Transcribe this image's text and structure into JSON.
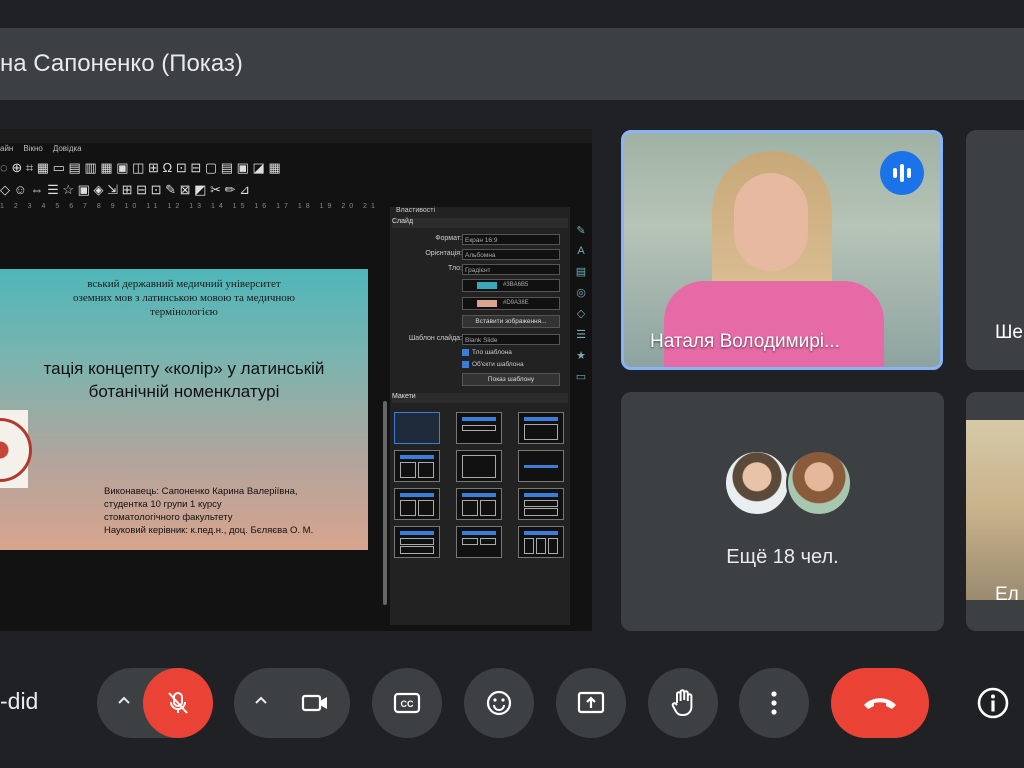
{
  "header": {
    "presenter_title": "на Сапоненко (Показ)"
  },
  "shared_screen": {
    "menu": [
      "айн",
      "Вікно",
      "Довідка"
    ],
    "slide": {
      "university_lines": [
        "вський державний медичний університет",
        "оземних мов з латинською мовою та медичною",
        "термінологією"
      ],
      "heading_lines": [
        "тація концепту «колір» у латинській",
        "ботанічній номенклатурі"
      ],
      "credits": "Виконавець: Сапоненко Карина Валеріївна,\nстудентка 10 групи 1 курсу\nстоматологічного факультету\nНауковий керівник: к.пед.н., доц. Бєляєва О. М."
    },
    "properties": {
      "panel_title": "Властивості",
      "slide_section": "Слайд",
      "format_label": "Формат:",
      "format_value": "Екран 16:9",
      "orientation_label": "Орієнтація:",
      "orientation_value": "Альбомна",
      "background_label": "Тло:",
      "background_value": "Градієнт",
      "color1": "#3BA6B5",
      "color1_label": "#3BA6B5",
      "color2": "#D9A38E",
      "color2_label": "#D9A38E",
      "insert_image_button": "Вставити зображення...",
      "master_label": "Шаблон слайда:",
      "master_value": "Blank Slide",
      "check1": "Тло шаблона",
      "check2": "Об'єкти шаблона",
      "master_slide_button": "Показ шаблону",
      "layouts_section": "Макети"
    }
  },
  "participants": {
    "active_speaker": {
      "name": "Наталя Володимирі..."
    },
    "right_top_partial_name": "Ше",
    "more": {
      "label": "Ещё 18 чел."
    },
    "right_bottom_partial_name": "Ел"
  },
  "controls": {
    "meeting_code": "-did",
    "mic_state": "muted",
    "buttons": [
      "mic-options",
      "mic",
      "camera-options",
      "camera",
      "captions",
      "emoji",
      "present",
      "raise-hand",
      "more-options",
      "end-call",
      "info"
    ]
  },
  "colors": {
    "accent_blue": "#8ab4f8",
    "danger_red": "#ea4335",
    "speaker_badge": "#1a73e8"
  }
}
